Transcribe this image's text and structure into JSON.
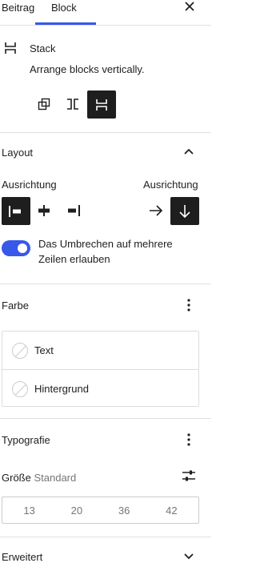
{
  "tabs": {
    "beitrag": "Beitrag",
    "block": "Block"
  },
  "block_card": {
    "title": "Stack",
    "description": "Arrange blocks vertically."
  },
  "layout": {
    "title": "Layout",
    "justify_label": "Ausrichtung",
    "orientation_label": "Ausrichtung",
    "wrap_label": "Das Umbrechen auf mehrere Zeilen erlauben",
    "wrap_enabled": true
  },
  "color": {
    "title": "Farbe",
    "items": [
      "Text",
      "Hintergrund"
    ]
  },
  "typography": {
    "title": "Typografie",
    "size_label": "Größe",
    "size_value": "Standard",
    "sizes": [
      "13",
      "20",
      "36",
      "42"
    ]
  },
  "advanced": {
    "title": "Erweitert"
  },
  "colors": {
    "accent": "#3858e9",
    "dark": "#1e1e1e",
    "border": "#e0e0e0"
  },
  "icons": [
    "close-icon",
    "stack-icon",
    "transform-icon",
    "row-icon",
    "stack-variation-icon",
    "chevron-up-icon",
    "justify-left-icon",
    "justify-center-icon",
    "justify-right-icon",
    "arrow-right-icon",
    "arrow-down-icon",
    "more-vertical-icon",
    "sliders-icon",
    "chevron-down-icon"
  ]
}
